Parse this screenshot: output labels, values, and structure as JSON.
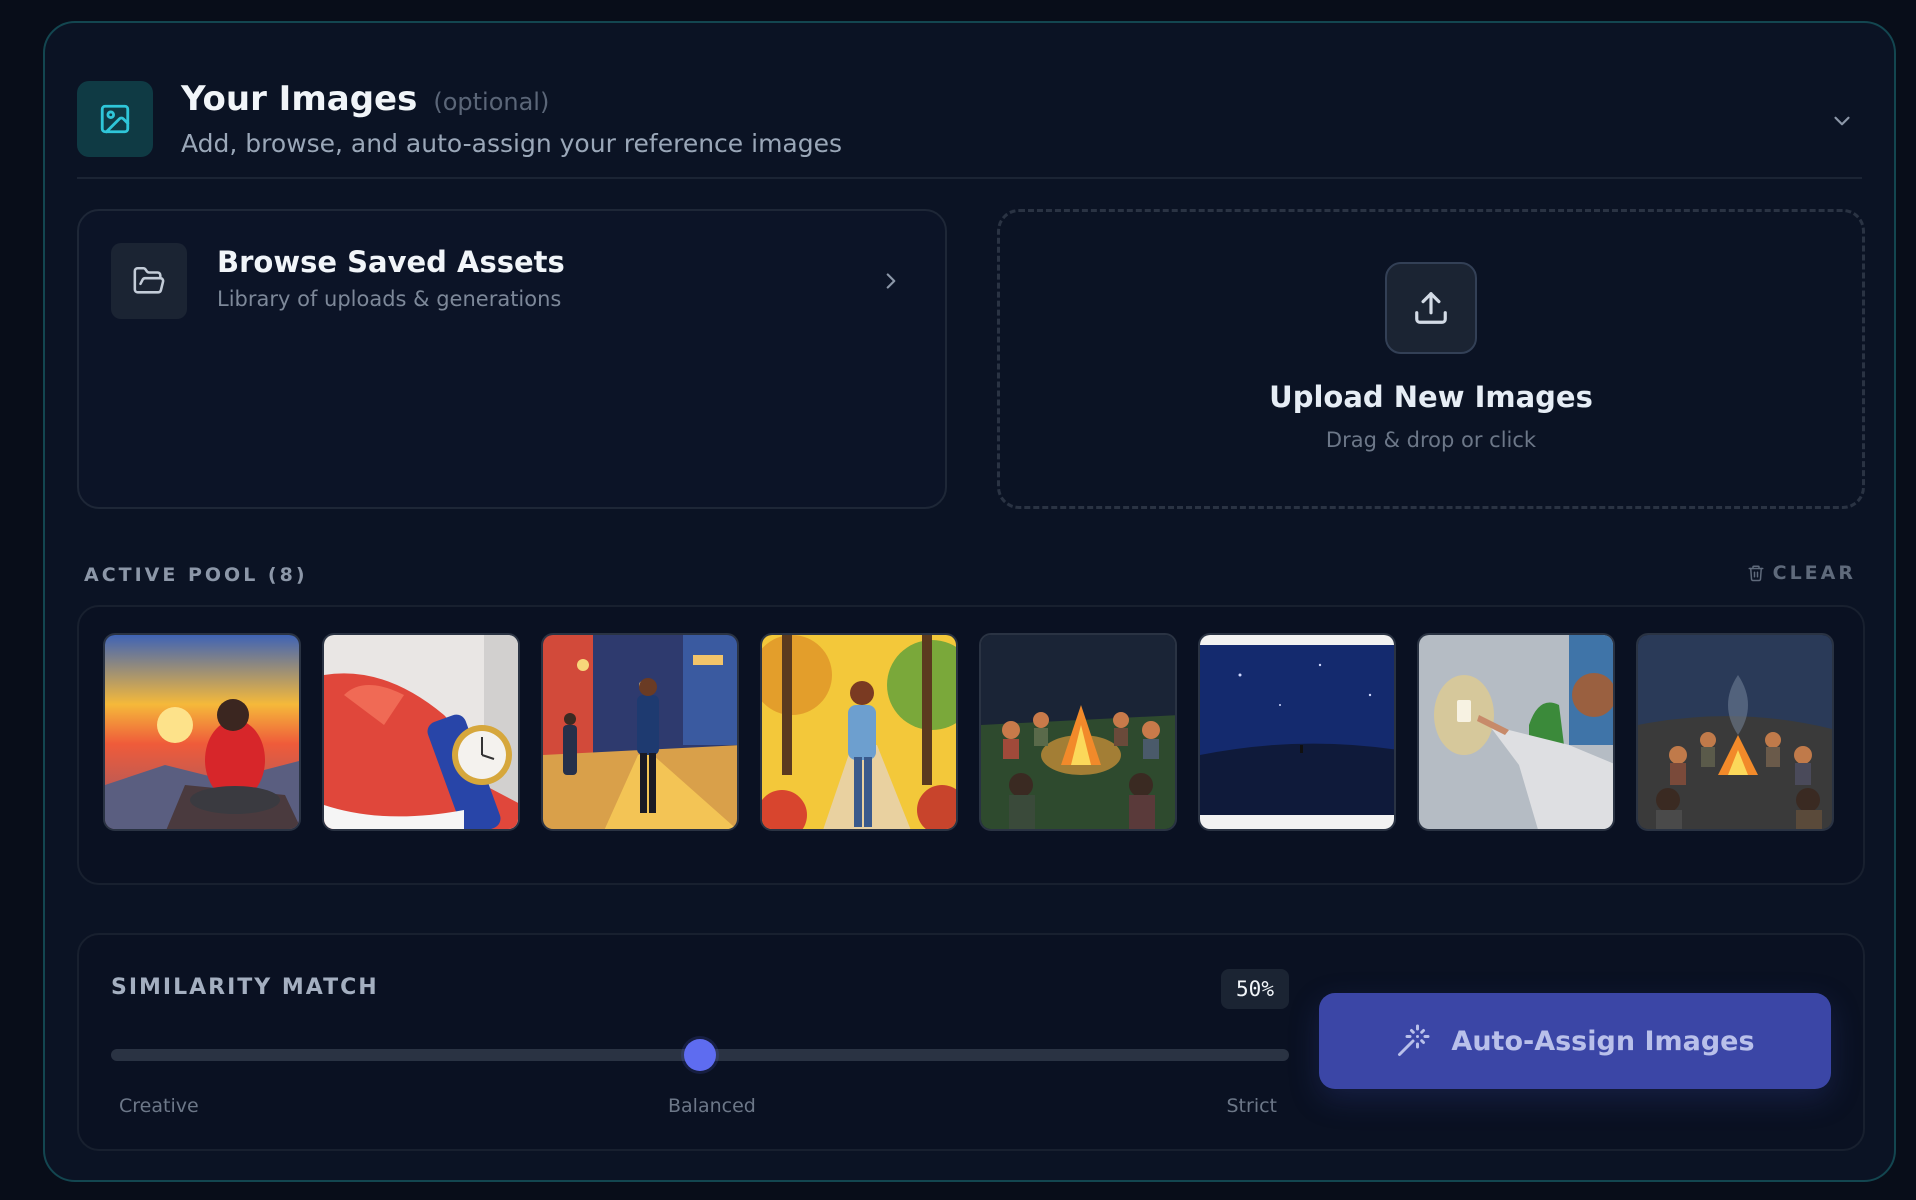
{
  "header": {
    "title": "Your Images",
    "optional": "(optional)",
    "subtitle": "Add, browse, and auto-assign your reference images"
  },
  "browse": {
    "title": "Browse Saved Assets",
    "subtitle": "Library of uploads & generations"
  },
  "upload": {
    "title": "Upload New Images",
    "subtitle": "Drag & drop or click"
  },
  "pool": {
    "label": "ACTIVE POOL (8)",
    "clear_label": "CLEAR",
    "images": [
      {
        "name": "sunset-meditation"
      },
      {
        "name": "hand-wristwatch"
      },
      {
        "name": "city-night-walk"
      },
      {
        "name": "autumn-forest-walk"
      },
      {
        "name": "campfire-circle"
      },
      {
        "name": "starry-night-field"
      },
      {
        "name": "light-switch-room"
      },
      {
        "name": "campfire-night"
      }
    ]
  },
  "similarity": {
    "label": "SIMILARITY MATCH",
    "value_display": "50%",
    "value": 0.5,
    "ticks": {
      "left": "Creative",
      "middle": "Balanced",
      "right": "Strict"
    }
  },
  "auto_assign": {
    "label": "Auto-Assign Images"
  },
  "colors": {
    "accent": "#5e6cf0",
    "button": "#3b46a6",
    "teal_border": "#134650"
  }
}
